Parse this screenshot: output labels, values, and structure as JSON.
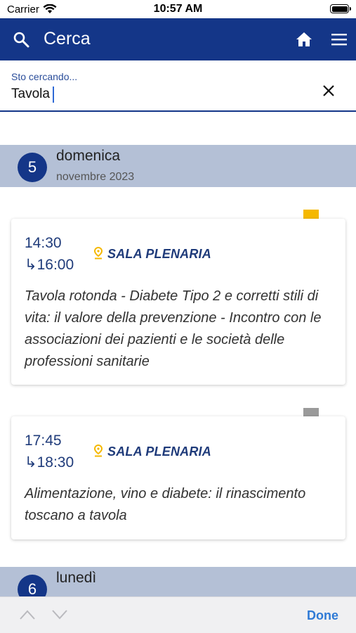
{
  "status_bar": {
    "carrier": "Carrier",
    "time": "10:57 AM"
  },
  "nav": {
    "title": "Cerca",
    "icons": [
      "search-icon",
      "home-icon",
      "menu-icon"
    ]
  },
  "search": {
    "label": "Sto cercando...",
    "value": "Tavola"
  },
  "days": [
    {
      "number": "5",
      "name": "domenica",
      "month": "novembre 2023",
      "events": [
        {
          "start": "14:30",
          "end": "↳16:00",
          "location": "SALA PLENARIA",
          "title": "Tavola rotonda - Diabete Tipo 2 e corretti stili di vita: il valore della prevenzione - Incontro con le associazioni dei pazienti e le società delle professioni sanitarie",
          "bookmarked": true
        },
        {
          "start": "17:45",
          "end": "↳18:30",
          "location": "SALA PLENARIA",
          "title": "Alimentazione, vino e diabete: il rinascimento toscano a tavola",
          "bookmarked": false
        }
      ]
    },
    {
      "number": "6",
      "name": "lunedì"
    }
  ],
  "toolbar": {
    "done": "Done"
  },
  "colors": {
    "primary": "#143688",
    "accent_bookmark": "#f5b800",
    "inactive_bookmark": "#9a9a9a",
    "day_header_bg": "#b4c0d6"
  }
}
